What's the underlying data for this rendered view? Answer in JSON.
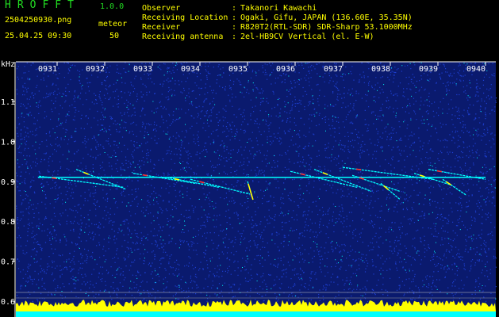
{
  "header": {
    "app_name": "HROFFT",
    "app_version": "1.0.0",
    "filename": "2504250930.png",
    "datetime": "25.04.25 09:30",
    "meteor_label": "meteor",
    "meteor_count": "50",
    "meta": [
      {
        "key": "Observer",
        "value": "Takanori Kawachi"
      },
      {
        "key": "Receiving Location",
        "value": "Ogaki, Gifu, JAPAN (136.60E, 35.35N)"
      },
      {
        "key": "Receiver",
        "value": "R820T2(RTL-SDR) SDR-Sharp 53.1000MHz"
      },
      {
        "key": "Receiving antenna",
        "value": "2el-HB9CV Vertical (el. E-W)"
      }
    ],
    "colors": {
      "title": "#22dd22",
      "text": "#ffff00",
      "axis": "#ffffff",
      "background": "#000000"
    }
  },
  "chart_data": {
    "type": "heatmap",
    "title": "",
    "ylabel": "kHz",
    "xlabel": "",
    "x_ticks": [
      "0931",
      "0932",
      "0933",
      "0934",
      "0935",
      "0936",
      "0937",
      "0938",
      "0939",
      "0940"
    ],
    "x_range": [
      930,
      940
    ],
    "y_ticks": [
      1.1,
      1.0,
      0.9,
      0.8,
      0.7,
      0.6
    ],
    "y_tick_labels": [
      "1.1",
      "1.0",
      "0.9",
      "0.8",
      "0.7",
      "0.6"
    ],
    "y_range": [
      0.58,
      1.18
    ],
    "carrier_khz": 0.91,
    "carrier_span": [
      930.6,
      940
    ],
    "colormap": [
      "#0a1a6e",
      "#1d3fd0",
      "#00ffff",
      "#ffff00",
      "#ff3030"
    ],
    "echoes": [
      {
        "x_start": 930.62,
        "x_end": 932.4,
        "f_start": 0.913,
        "f_end": 0.885
      },
      {
        "x_start": 931.4,
        "x_end": 932.45,
        "f_start": 0.93,
        "f_end": 0.88
      },
      {
        "x_start": 932.6,
        "x_end": 933.9,
        "f_start": 0.92,
        "f_end": 0.895
      },
      {
        "x_start": 933.3,
        "x_end": 934.4,
        "f_start": 0.91,
        "f_end": 0.885
      },
      {
        "x_start": 933.8,
        "x_end": 935.05,
        "f_start": 0.905,
        "f_end": 0.868
      },
      {
        "x_start": 935.0,
        "x_end": 935.1,
        "f_start": 0.9,
        "f_end": 0.86
      },
      {
        "x_start": 935.9,
        "x_end": 937.3,
        "f_start": 0.925,
        "f_end": 0.885
      },
      {
        "x_start": 936.4,
        "x_end": 937.6,
        "f_start": 0.93,
        "f_end": 0.875
      },
      {
        "x_start": 937.2,
        "x_end": 938.2,
        "f_start": 0.915,
        "f_end": 0.875
      },
      {
        "x_start": 937.8,
        "x_end": 938.2,
        "f_start": 0.895,
        "f_end": 0.855
      },
      {
        "x_start": 937.0,
        "x_end": 938.9,
        "f_start": 0.935,
        "f_end": 0.905
      },
      {
        "x_start": 938.5,
        "x_end": 939.3,
        "f_start": 0.92,
        "f_end": 0.89
      },
      {
        "x_start": 938.8,
        "x_end": 940.0,
        "f_start": 0.93,
        "f_end": 0.905
      },
      {
        "x_start": 939.1,
        "x_end": 939.6,
        "f_start": 0.905,
        "f_end": 0.865
      }
    ]
  }
}
